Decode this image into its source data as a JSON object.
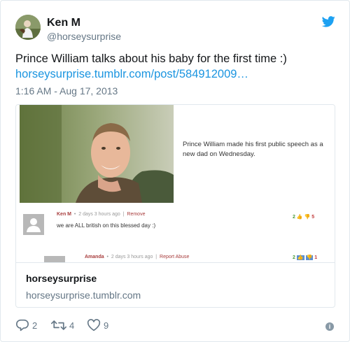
{
  "user": {
    "name": "Ken M",
    "handle": "@horseysurprise"
  },
  "tweet": {
    "text": "Prince William talks about his baby for the first time :)",
    "link": "horseysurprise.tumblr.com/post/584912009…",
    "timestamp": "1:16 AM - Aug 17, 2013"
  },
  "card": {
    "photo_caption": "Prince William made his first public speech as a new dad on Wednesday.",
    "comments": [
      {
        "user": "Ken M",
        "time": "2 days 3 hours ago",
        "link": "Remove",
        "text": "we are ALL british on this blessed day :)",
        "up": "2",
        "down": "5"
      },
      {
        "user": "Amanda",
        "time": "2 days 3 hours ago",
        "link": "Report Abuse",
        "up": "2",
        "down": "1"
      }
    ],
    "title": "horseysurprise",
    "domain": "horseysurprise.tumblr.com"
  },
  "actions": {
    "replies": "2",
    "retweets": "4",
    "likes": "9"
  },
  "icons": {
    "bird": "twitter-bird-icon",
    "reply": "reply-icon",
    "retweet": "retweet-icon",
    "like": "heart-icon",
    "info": "info-icon"
  },
  "colors": {
    "link": "#1b95e0",
    "bird": "#1da1f2",
    "muted": "#657786",
    "border": "#e1e8ed"
  }
}
